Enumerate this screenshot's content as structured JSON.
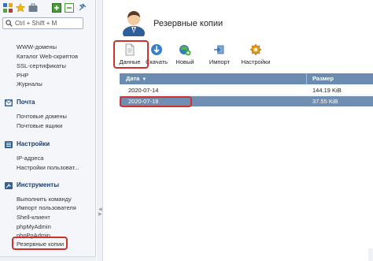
{
  "sidebar": {
    "search_placeholder": "Ctrl + Shift + M",
    "top_icons": [
      "grid-icon",
      "star-icon",
      "briefcase-icon",
      "expand-all-icon",
      "collapse-all-icon",
      "pin-icon"
    ],
    "group_web": {
      "items": [
        "WWW-домены",
        "Каталог Web-скриптов",
        "SSL-сертификаты",
        "PHP",
        "Журналы"
      ]
    },
    "group_mail": {
      "title": "Почта",
      "items": [
        "Почтовые домены",
        "Почтовые ящики"
      ]
    },
    "group_settings": {
      "title": "Настройки",
      "items": [
        "IP-адреса",
        "Настройки пользоват..."
      ]
    },
    "group_tools": {
      "title": "Инструменты",
      "items": [
        "Выполнить команду",
        "Импорт пользователя",
        "Shell-клиент",
        "phpMyAdmin",
        "phpPgAdmin",
        "Резервные копии"
      ]
    }
  },
  "main": {
    "title": "Резервные копии",
    "toolbar": {
      "data": "Данные",
      "download": "Скачать",
      "new": "Новый",
      "import": "Импорт",
      "settings": "Настройки"
    },
    "table": {
      "columns": {
        "date": "Дата",
        "size": "Размер"
      },
      "rows": [
        {
          "date": "2020-07-14",
          "size": "144.19 KiB"
        },
        {
          "date": "2020-07-18",
          "size": "37.55 KiB"
        }
      ]
    }
  },
  "colors": {
    "highlight": "#d0312d",
    "table_header": "#6a8cb0",
    "selected_row": "#6f8eb1",
    "section_title": "#1a3d6d"
  }
}
